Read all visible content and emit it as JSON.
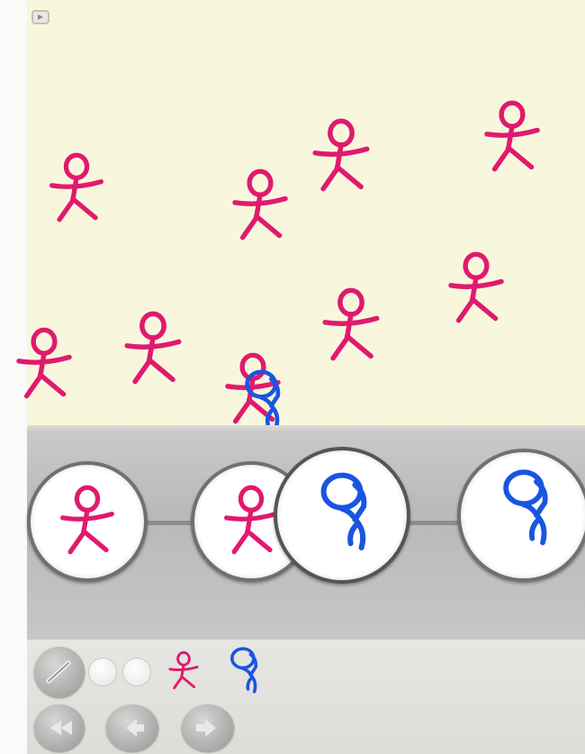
{
  "app": {
    "colors": {
      "canvas": "#f8f7dd",
      "stickman": "#e01a6e",
      "blob": "#1a55e0",
      "strip": "#bdbdbb",
      "toolbar": "#dfdfdb"
    }
  },
  "canvas": {
    "icons": [
      "pink-stickman-icon",
      "blue-blob-icon",
      "corner-menu-icon"
    ]
  },
  "timeline": {
    "frames": [
      {
        "content": "pink-stickman-icon",
        "selected": false
      },
      {
        "content": "pink-stickman-icon",
        "selected": false
      },
      {
        "content": "blue-blob-icon",
        "selected": true
      },
      {
        "content": "blue-blob-icon",
        "selected": false
      }
    ]
  },
  "toolbar": {
    "tools": [
      "pen-icon",
      "blank-swatch",
      "blank-swatch",
      "pink-stickman-icon",
      "blue-blob-icon"
    ],
    "buttons": [
      "rewind-icon",
      "back-icon",
      "forward-icon"
    ]
  }
}
